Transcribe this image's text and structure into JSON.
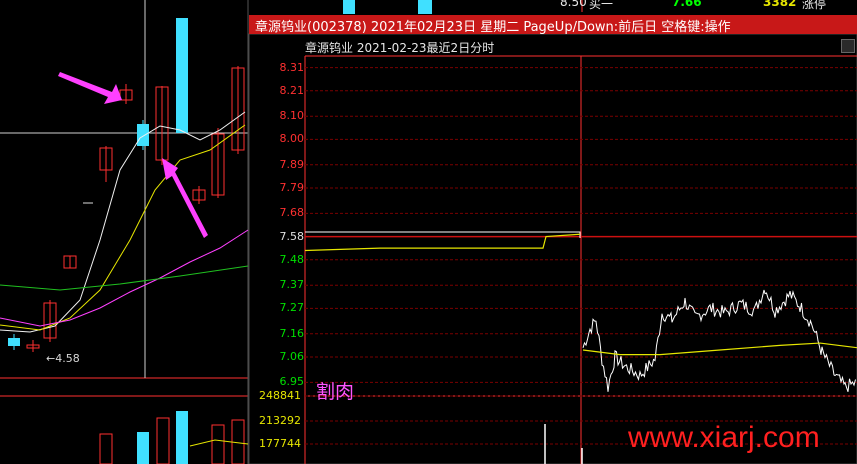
{
  "window": {
    "title": "章源钨业(002378) 2021年02月23日 星期二 PageUp/Down:前后日 空格键:操作",
    "subtitle": "章源钨业  2021-02-23最近2日分时"
  },
  "top_strip": {
    "price": "8.50",
    "label": "买一",
    "bid_price": "7.66",
    "bid_volume": "3382",
    "status": "涨停"
  },
  "kline": {
    "low_label": "←4.58"
  },
  "chart_data": {
    "type": "line",
    "title": "章源钨业  2021-02-23最近2日分时",
    "price_axis_ticks": [
      "8.31",
      "8.21",
      "8.10",
      "8.00",
      "7.89",
      "7.79",
      "7.68",
      "7.58",
      "7.48",
      "7.37",
      "7.27",
      "7.16",
      "7.06",
      "6.95"
    ],
    "price_axis_range": [
      6.9,
      8.36
    ],
    "volume_axis_ticks": [
      "248841",
      "213292",
      "177744"
    ],
    "series": [],
    "day1": {
      "price_line": 7.6,
      "avg_line": [
        7.52,
        7.53,
        7.54,
        7.6
      ]
    },
    "day2": {
      "price_range": [
        6.91,
        7.38
      ],
      "avg_line_approx": 7.1
    },
    "colors": {
      "up": "#ff3030",
      "down": "#00ff00",
      "line": "#ffffff",
      "avg": "#e6e600",
      "grid": "#8b0000"
    }
  },
  "annotations": {
    "label": "割肉"
  },
  "watermark": "www.xiarj.com"
}
